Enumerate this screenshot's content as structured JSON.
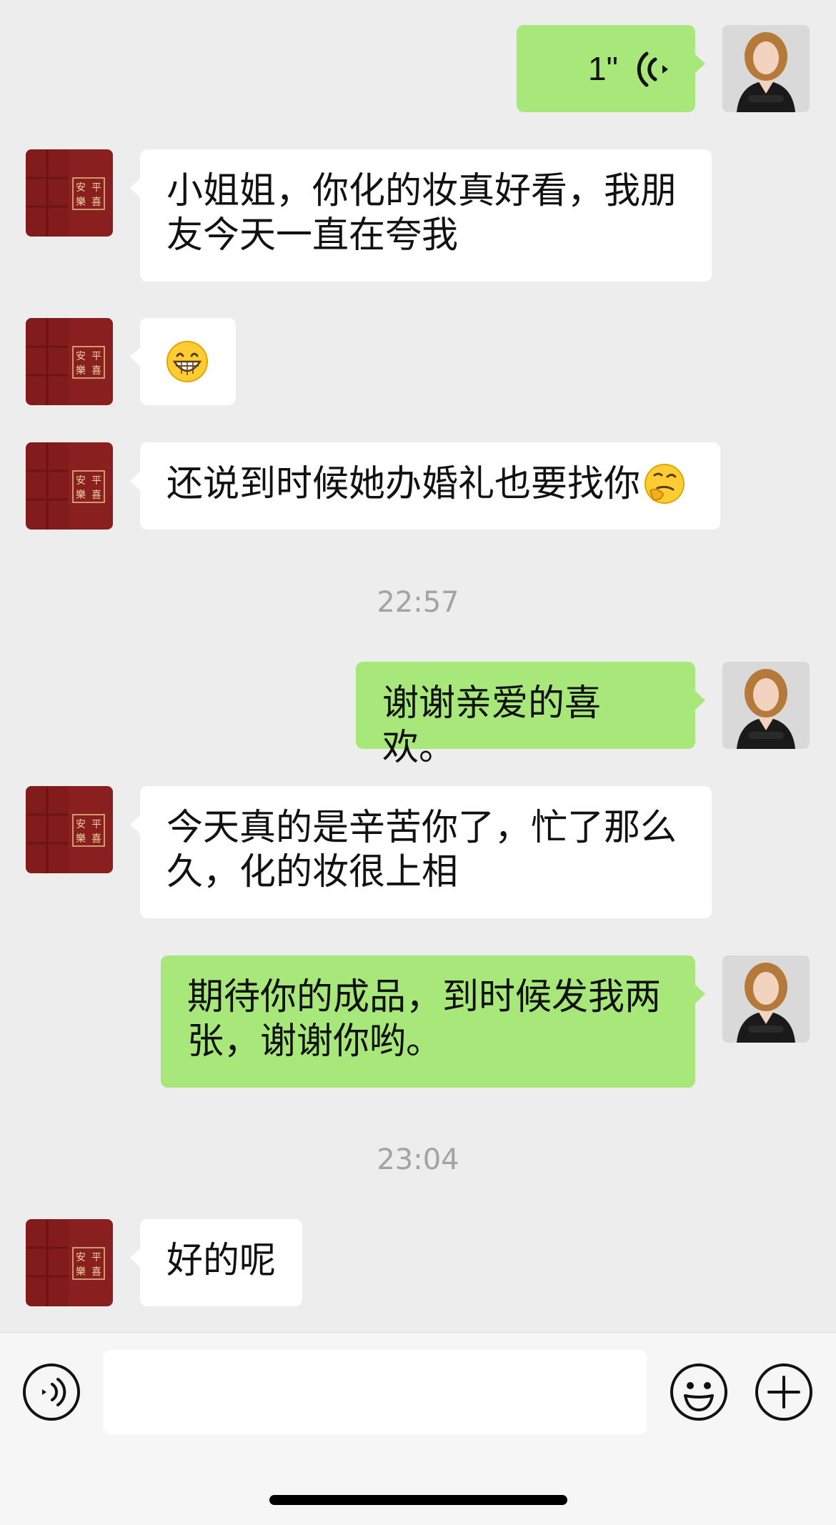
{
  "messages": [
    {
      "id": "m1",
      "side": "out",
      "type": "voice",
      "duration": "1\""
    },
    {
      "id": "m2",
      "side": "in",
      "text": "小姐姐，你化的妆真好看，我朋友今天一直在夸我"
    },
    {
      "id": "m3",
      "side": "in",
      "type": "emoji",
      "emoji": "grinning-face-icon"
    },
    {
      "id": "m4",
      "side": "in",
      "text": "还说到时候她办婚礼也要找你",
      "emoji": "thinking-face-icon"
    },
    {
      "id": "t1",
      "type": "time",
      "text": "22:57"
    },
    {
      "id": "m5",
      "side": "out",
      "text": "谢谢亲爱的喜欢。"
    },
    {
      "id": "m6",
      "side": "in",
      "text": "今天真的是辛苦你了，忙了那么久，化的妆很上相"
    },
    {
      "id": "m7",
      "side": "out",
      "text": "期待你的成品，到时候发我两张，谢谢你哟。"
    },
    {
      "id": "t2",
      "type": "time",
      "text": "23:04"
    },
    {
      "id": "m8",
      "side": "in",
      "text": "好的呢"
    }
  ],
  "contact_avatar": {
    "seal_text": "平安喜樂",
    "color": "#8a1f1f"
  },
  "my_avatar": {
    "bg": "#d9d9d9",
    "hair": "#b57a3a",
    "outfit": "#1a1a1a"
  },
  "input_bar": {
    "value": "",
    "voice_icon": "voice-mode-icon",
    "emoji_icon": "emoji-icon",
    "plus_icon": "plus-icon"
  },
  "colors": {
    "background": "#ededed",
    "incoming": "#ffffff",
    "outgoing": "#a8e87b",
    "timestamp": "#a3a3a3"
  }
}
